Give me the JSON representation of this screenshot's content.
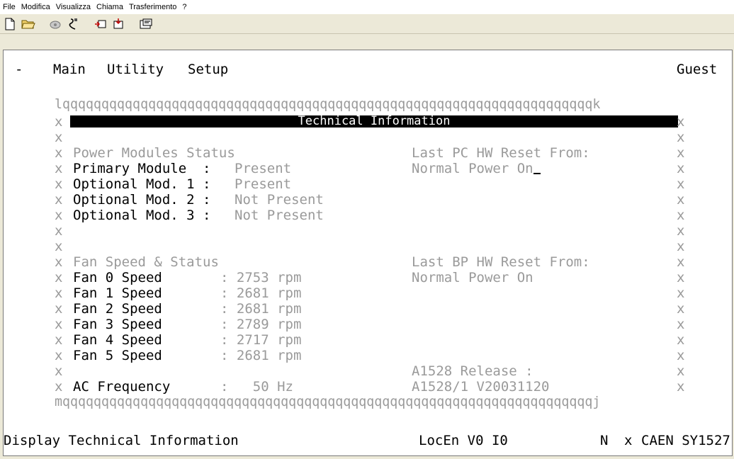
{
  "menu": {
    "items": [
      "File",
      "Modifica",
      "Visualizza",
      "Chiama",
      "Trasferimento",
      "?"
    ]
  },
  "toolbar": {
    "icons": [
      "new-file-icon",
      "open-folder-icon",
      "call-icon",
      "disconnect-icon",
      "send-icon",
      "receive-icon",
      "properties-icon"
    ]
  },
  "terminal": {
    "header": {
      "dash": "-",
      "menu_main": "Main",
      "menu_utility": "Utility",
      "menu_setup": "Setup",
      "user": "Guest"
    },
    "top_border": "lqqqqqqqqqqqqqqqqqqqqqqqqqqqqqqqqqqqqqqqqqqqqqqqqqqqqqqqqqqqqqqqqqqqqk",
    "bottom_border": "mqqqqqqqqqqqqqqqqqqqqqqqqqqqqqqqqqqqqqqqqqqqqqqqqqqqqqqqqqqqqqqqqqqqqj",
    "title": "Technical Information",
    "power": {
      "heading": "Power Modules Status",
      "rows": [
        {
          "label": "Primary Module  :",
          "value": "Present"
        },
        {
          "label": "Optional Mod. 1 :",
          "value": "Present"
        },
        {
          "label": "Optional Mod. 2 :",
          "value": "Not Present"
        },
        {
          "label": "Optional Mod. 3 :",
          "value": "Not Present"
        }
      ]
    },
    "pc_reset": {
      "heading": "Last PC HW Reset From:",
      "value": "Normal Power On"
    },
    "fans": {
      "heading": "Fan Speed & Status",
      "rows": [
        {
          "label": "Fan 0 Speed",
          "value": ": 2753 rpm"
        },
        {
          "label": "Fan 1 Speed",
          "value": ": 2681 rpm"
        },
        {
          "label": "Fan 2 Speed",
          "value": ": 2681 rpm"
        },
        {
          "label": "Fan 3 Speed",
          "value": ": 2789 rpm"
        },
        {
          "label": "Fan 4 Speed",
          "value": ": 2717 rpm"
        },
        {
          "label": "Fan 5 Speed",
          "value": ": 2681 rpm"
        }
      ]
    },
    "bp_reset": {
      "heading": "Last BP HW Reset From:",
      "value": "Normal Power On"
    },
    "ac": {
      "label": "AC Frequency",
      "value": ":   50 Hz"
    },
    "release": {
      "heading": "A1528 Release :",
      "value": "A1528/1 V20031120"
    },
    "border_char": "x",
    "status": {
      "left": "Display Technical Information",
      "mode": "LocEn V0 I0",
      "flag": "N",
      "sep": "x",
      "device": "CAEN SY1527"
    }
  }
}
